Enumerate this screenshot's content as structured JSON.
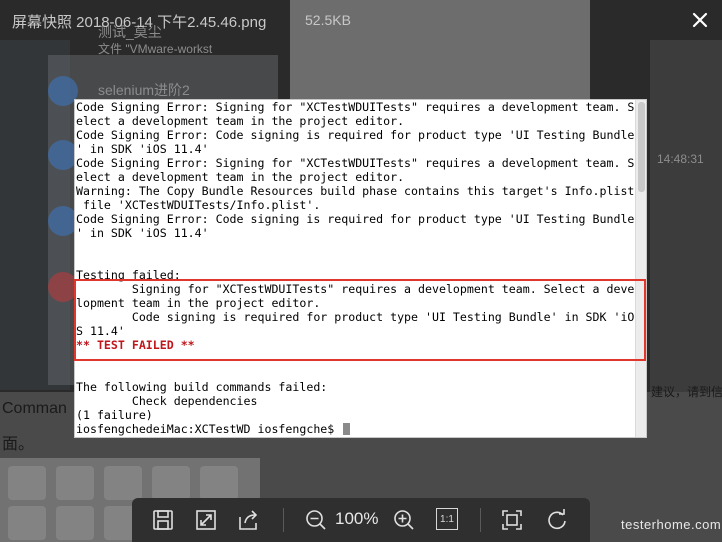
{
  "viewer": {
    "file_name": "屏幕快照 2018-06-14 下午2.45.46.png",
    "file_size": "52.5KB",
    "zoom": "100%",
    "actual_size_label": "1:1",
    "watermark": "testerhome.com"
  },
  "background": {
    "chat_item_1_name": "测试_莫尘",
    "chat_item_1_sub": "文件 \"VMware-workst",
    "chat_item_2_name": "selenium进阶2",
    "timestamp": "14:48:31",
    "left_text_1": "Comman",
    "left_text_2": "面。",
    "right_text": "建议，请到信"
  },
  "terminal": {
    "lines": [
      {
        "text": "Code Signing Error: Signing for \"XCTestWDUITests\" requires a development team. S",
        "style": "normal"
      },
      {
        "text": "elect a development team in the project editor.",
        "style": "normal"
      },
      {
        "text": "Code Signing Error: Code signing is required for product type 'UI Testing Bundle",
        "style": "normal"
      },
      {
        "text": "' in SDK 'iOS 11.4'",
        "style": "normal"
      },
      {
        "text": "Code Signing Error: Signing for \"XCTestWDUITests\" requires a development team. S",
        "style": "normal"
      },
      {
        "text": "elect a development team in the project editor.",
        "style": "normal"
      },
      {
        "text": "Warning: The Copy Bundle Resources build phase contains this target's Info.plist",
        "style": "normal"
      },
      {
        "text": " file 'XCTestWDUITests/Info.plist'.",
        "style": "normal"
      },
      {
        "text": "Code Signing Error: Code signing is required for product type 'UI Testing Bundle",
        "style": "normal"
      },
      {
        "text": "' in SDK 'iOS 11.4'",
        "style": "normal"
      },
      {
        "text": "",
        "style": "normal"
      },
      {
        "text": "",
        "style": "normal"
      },
      {
        "text": "Testing failed:",
        "style": "normal"
      },
      {
        "text": "        Signing for \"XCTestWDUITests\" requires a development team. Select a deve",
        "style": "normal"
      },
      {
        "text": "lopment team in the project editor.",
        "style": "normal"
      },
      {
        "text": "        Code signing is required for product type 'UI Testing Bundle' in SDK 'iO",
        "style": "normal"
      },
      {
        "text": "S 11.4'",
        "style": "normal"
      },
      {
        "text": "** TEST FAILED **",
        "style": "red"
      },
      {
        "text": "",
        "style": "normal"
      },
      {
        "text": "",
        "style": "normal"
      },
      {
        "text": "The following build commands failed:",
        "style": "normal"
      },
      {
        "text": "        Check dependencies",
        "style": "normal"
      },
      {
        "text": "(1 failure)",
        "style": "normal"
      }
    ],
    "prompt": "iosfengchedeiMac:XCTestWD iosfengche$ "
  },
  "icons": {
    "close": "close-icon",
    "save": "save-icon",
    "fit": "fit-window-icon",
    "share": "share-icon",
    "zoom_out": "zoom-out-icon",
    "zoom_in": "zoom-in-icon",
    "fullscreen": "fullscreen-icon",
    "rotate": "rotate-icon"
  },
  "colors": {
    "highlight": "#e0362b",
    "error_text": "#c1161b"
  }
}
